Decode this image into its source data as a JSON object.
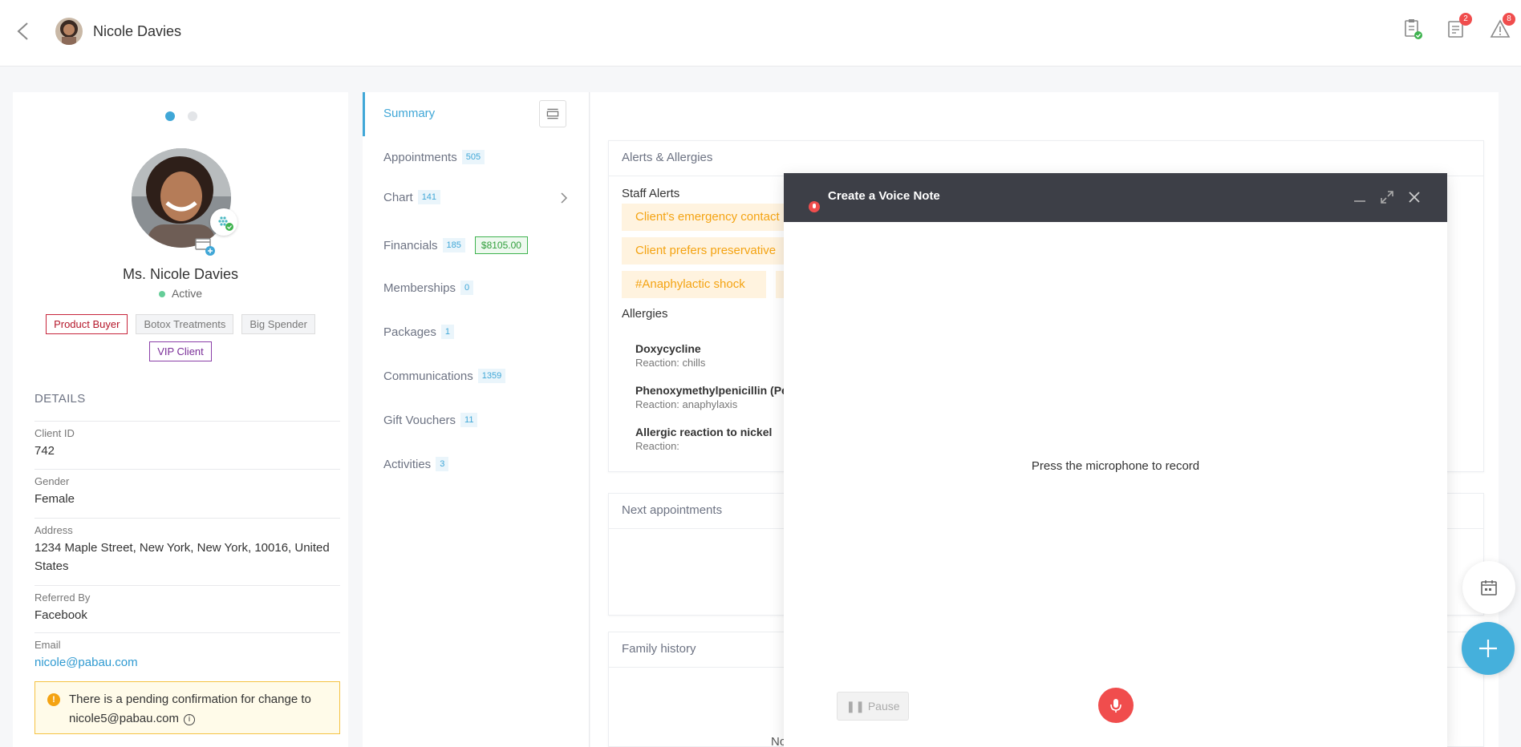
{
  "header": {
    "client_name": "Nicole Davies",
    "icons": [
      {
        "name": "clipboard-check-icon",
        "badge": ""
      },
      {
        "name": "notes-icon",
        "badge": "2"
      },
      {
        "name": "alert-triangle-icon",
        "badge": "8"
      }
    ]
  },
  "profile": {
    "name": "Ms. Nicole Davies",
    "status": "Active",
    "tags": [
      "Product Buyer",
      "Botox Treatments",
      "Big Spender",
      "VIP Client"
    ],
    "details_title": "DETAILS",
    "details": [
      {
        "label": "Client ID",
        "value": "742"
      },
      {
        "label": "Gender",
        "value": "Female"
      },
      {
        "label": "Address",
        "value": "1234 Maple Street, New York, New York, 10016, United States"
      },
      {
        "label": "Referred By",
        "value": "Facebook"
      },
      {
        "label": "Email",
        "value": "nicole@pabau.com"
      }
    ],
    "pending_text": "There is a pending confirmation for change to nicole5@pabau.com"
  },
  "nav": [
    {
      "label": "Summary",
      "count": ""
    },
    {
      "label": "Appointments",
      "count": "505"
    },
    {
      "label": "Chart",
      "count": "141"
    },
    {
      "label": "Financials",
      "count": "185",
      "amount": "$8105.00"
    },
    {
      "label": "Memberships",
      "count": "0"
    },
    {
      "label": "Packages",
      "count": "1"
    },
    {
      "label": "Communications",
      "count": "1359"
    },
    {
      "label": "Gift Vouchers",
      "count": "11"
    },
    {
      "label": "Activities",
      "count": "3"
    }
  ],
  "alerts_panel": {
    "title": "Alerts & Allergies",
    "staff_alerts_title": "Staff Alerts",
    "staff_alerts": [
      "Client's emergency contact",
      "Client prefers preservative",
      "#Anaphylactic shock"
    ],
    "allergies_title": "Allergies",
    "allergies": [
      {
        "name": "Doxycycline",
        "reaction": "Reaction: chills"
      },
      {
        "name": "Phenoxymethylpenicillin (Pe",
        "reaction": "Reaction: anaphylaxis"
      },
      {
        "name": "Allergic reaction to nickel",
        "reaction": "Reaction:"
      }
    ]
  },
  "next_appointments_panel": {
    "title": "Next appointments"
  },
  "family_history_panel": {
    "title": "Family history",
    "partial_text": "No"
  },
  "voice_modal": {
    "title": "Create a Voice Note",
    "hint": "Press the microphone to record",
    "pause_label": "Pause"
  },
  "colors": {
    "accent": "#40a7d7",
    "record": "#f04d4d",
    "warning": "#f4a312",
    "modal_header": "#3d3f47"
  }
}
